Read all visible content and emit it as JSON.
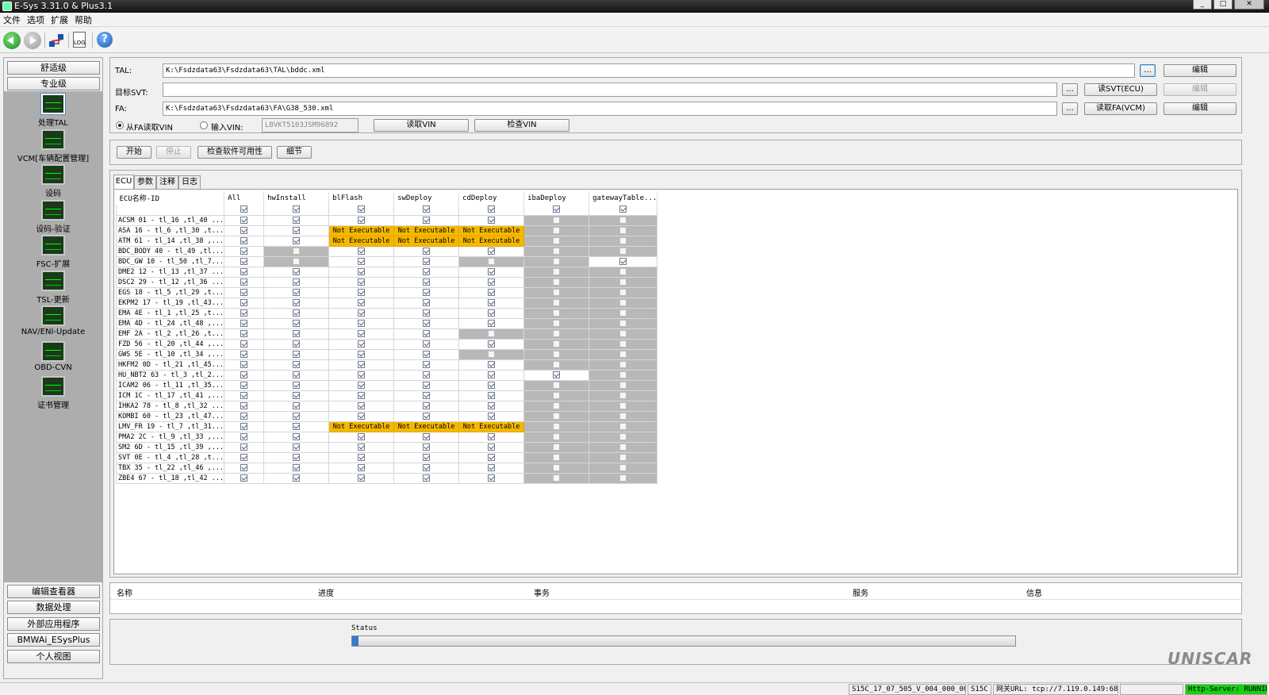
{
  "window": {
    "title": "E-Sys 3.31.0 & Plus3.1"
  },
  "menu": [
    "文件",
    "选项",
    "扩展",
    "帮助"
  ],
  "sidebar": {
    "top_buttons": [
      "舒适级",
      "专业级"
    ],
    "items": [
      {
        "label": "处理TAL"
      },
      {
        "label": "VCM[车辆配置管理]"
      },
      {
        "label": "设码"
      },
      {
        "label": "设码-验证"
      },
      {
        "label": "FSC-扩展"
      },
      {
        "label": "TSL-更新"
      },
      {
        "label": "NAV/ENI-Update"
      },
      {
        "label": "OBD-CVN"
      },
      {
        "label": "证书管理"
      }
    ],
    "bottom_buttons": [
      "编辑查看器",
      "数据处理",
      "外部应用程序",
      "BMWAi_ESysPlus",
      "个人视图"
    ]
  },
  "config": {
    "tal_label": "TAL:",
    "tal_value": "K:\\Fsdzdata63\\Fsdzdata63\\TAL\\bddc.xml",
    "svt_label": "目标SVT:",
    "svt_value": "",
    "fa_label": "FA:",
    "fa_value": "K:\\Fsdzdata63\\Fsdzdata63\\FA\\G38_530.xml",
    "browse": "...",
    "edit": "编辑",
    "read_svt": "读SVT(ECU)",
    "read_fa": "读取FA(VCM)",
    "radio_fa": "从FA读取VIN",
    "radio_input": "输入VIN:",
    "vin_value": "LBVKT5103JSM96892",
    "read_vin": "读取VIN",
    "check_vin": "检查VIN"
  },
  "actions": {
    "start": "开始",
    "stop": "停止",
    "check_sw": "检查软件可用性",
    "detail": "细节"
  },
  "tabs": [
    "ECU",
    "参数",
    "注释",
    "日志"
  ],
  "grid": {
    "headers": [
      "ECU名称-ID",
      "All",
      "hwInstall",
      "blFlash",
      "swDeploy",
      "cdDeploy",
      "ibaDeploy",
      "gatewayTable..."
    ],
    "not_exec": "Not Executable",
    "rows": [
      {
        "name": "",
        "c": "CCCCCCC"
      },
      {
        "name": "ACSM 01 - tl_16 ,tl_40 ...",
        "c": "CCCCCNN"
      },
      {
        "name": "ASA 16 - tl_6 ,tl_30 ,t...",
        "c": "CCEEENN"
      },
      {
        "name": "ATM 61 - tl_14 ,tl_38 ,...",
        "c": "CCEEENN"
      },
      {
        "name": "BDC_BODY 40 - tl_49 ,tl...",
        "c": "CXCCCNN"
      },
      {
        "name": "BDC_GW 10 - tl_50 ,tl_7...",
        "c": "CXCCXNC"
      },
      {
        "name": "DME2 12 - tl_13 ,tl_37 ...",
        "c": "CCCCCNN"
      },
      {
        "name": "DSC2 29 - tl_12 ,tl_36 ...",
        "c": "CCCCCNN"
      },
      {
        "name": "EGS 18 - tl_5 ,tl_29 ,t...",
        "c": "CCCCCNN"
      },
      {
        "name": "EKPM2 17 - tl_19 ,tl_43...",
        "c": "CCCCCNN"
      },
      {
        "name": "EMA 4E - tl_1 ,tl_25 ,t...",
        "c": "CCCCCNN"
      },
      {
        "name": "EMA 4D - tl_24 ,tl_48 ,...",
        "c": "CCCCCNN"
      },
      {
        "name": "EMF 2A - tl_2 ,tl_26 ,t...",
        "c": "CCCCXNN"
      },
      {
        "name": "FZD 56 - tl_20 ,tl_44 ,...",
        "c": "CCCCCNN"
      },
      {
        "name": "GWS 5E - tl_10 ,tl_34 ,...",
        "c": "CCCCXNN"
      },
      {
        "name": "HKFM2 0D - tl_21 ,tl_45...",
        "c": "CCCCCNN"
      },
      {
        "name": "HU_NBT2 63 - tl_3 ,tl_2...",
        "c": "CCCCCCN"
      },
      {
        "name": "ICAM2 06 - tl_11 ,tl_35...",
        "c": "CCCCCNN"
      },
      {
        "name": "ICM 1C - tl_17 ,tl_41 ,...",
        "c": "CCCCCNN"
      },
      {
        "name": "IHKA2 78 - tl_8 ,tl_32 ...",
        "c": "CCCCCNN"
      },
      {
        "name": "KOMBI 60 - tl_23 ,tl_47...",
        "c": "CCCCCNN"
      },
      {
        "name": "LMV_FR 19 - tl_7 ,tl_31...",
        "c": "CCEEENN"
      },
      {
        "name": "PMA2 2C - tl_9 ,tl_33 ,...",
        "c": "CCCCCNN"
      },
      {
        "name": "SM2 6D - tl_15 ,tl_39 ,...",
        "c": "CCCCCNN"
      },
      {
        "name": "SVT 0E - tl_4 ,tl_28 ,t...",
        "c": "CCCCCNN"
      },
      {
        "name": "TBX 35 - tl_22 ,tl_46 ,...",
        "c": "CCCCCNN"
      },
      {
        "name": "ZBE4 67 - tl_18 ,tl_42 ...",
        "c": "CCCCCNN"
      }
    ]
  },
  "info_headers": [
    "名称",
    "进度",
    "事务",
    "服务",
    "信息"
  ],
  "status": {
    "label": "Status",
    "progress": 0.01
  },
  "logo": "UNISCAR",
  "statusbar": {
    "version": "S15C_17_07_505_V_004_000_002",
    "series": "S15C",
    "gateway": "网关URL: tcp://7.119.0.149:6801",
    "empty": "",
    "server": "Http-Server: RUNNING"
  }
}
